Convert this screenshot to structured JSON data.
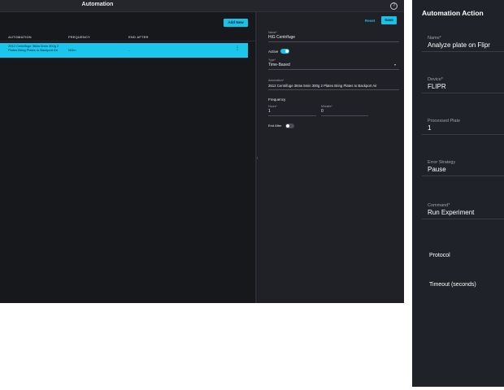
{
  "app": {
    "title": "Automation"
  },
  "table": {
    "add_label": "Add New",
    "columns": [
      "AUTOMATION",
      "FREQUENCY",
      "END AFTER"
    ],
    "rows": [
      {
        "automation": "2512 Centrifuge 384w 5min 300g 2 Plates Bring Plates to Backport Air",
        "frequency": "N/3m",
        "end_after": "-"
      }
    ]
  },
  "form": {
    "reset_label": "Reset",
    "save_label": "Save",
    "name": {
      "label": "Name*",
      "value": "HiG Centrifuge"
    },
    "active": {
      "label": "Active",
      "on": true
    },
    "type": {
      "label": "Type*",
      "value": "Time-Based"
    },
    "automation": {
      "label": "Automation*",
      "value": "2512 Centrifuge 384w 5min 300g 2 Plates Bring Plates to Backport Air"
    },
    "frequency": {
      "label": "Frequency",
      "hours": {
        "label": "Hours*",
        "value": "1"
      },
      "minutes": {
        "label": "Minutes*",
        "value": "0"
      }
    },
    "end_after": {
      "label": "End After",
      "on": false
    }
  },
  "action_panel": {
    "title": "Automation Action",
    "fields": [
      {
        "label": "Name*",
        "value": "Analyze plate on Flipr"
      },
      {
        "label": "Device*",
        "value": "FLIPR"
      },
      {
        "label": "Processed Plate",
        "value": "1"
      },
      {
        "label": "Error Strategy",
        "value": "Pause"
      },
      {
        "label": "Command*",
        "value": "Run Experiment"
      }
    ],
    "protocol_label": "Protocol",
    "timeout_label": "Timeout (seconds)"
  },
  "colors": {
    "accent": "#18c1e8",
    "background": "#1a1c21",
    "panel": "#1f2126"
  },
  "icons": {
    "help": "help-circle-icon",
    "kebab": "kebab-menu-icon",
    "chevron": "chevron-down-icon"
  }
}
